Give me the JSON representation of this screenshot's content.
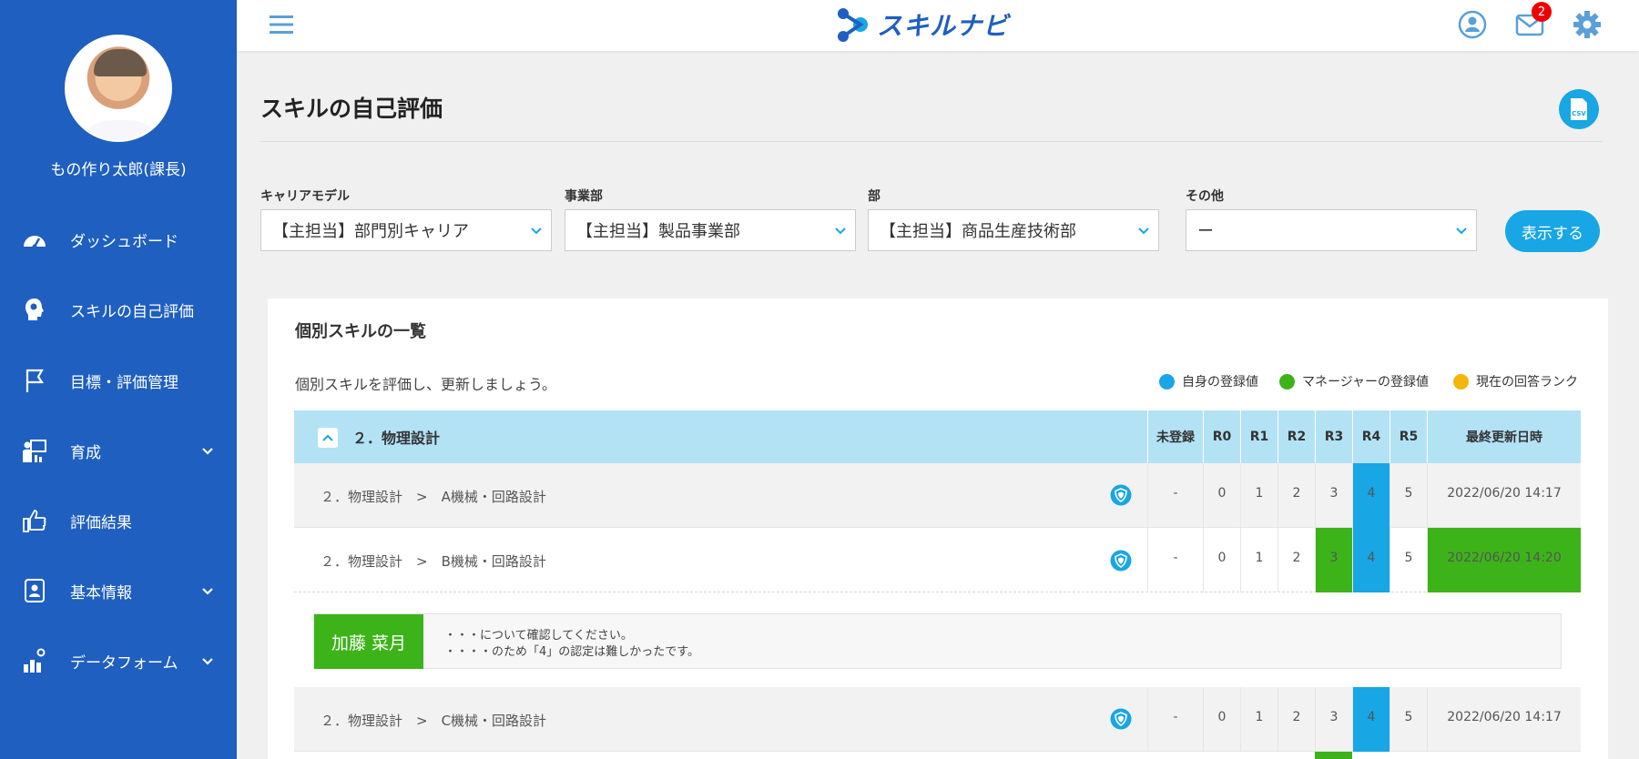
{
  "sidebar": {
    "user_name": "もの作り太郎(課長)",
    "items": [
      {
        "label": "ダッシュボード",
        "icon": "gauge-icon"
      },
      {
        "label": "スキルの自己評価",
        "icon": "brain-head-icon"
      },
      {
        "label": "目標・評価管理",
        "icon": "flag-icon"
      },
      {
        "label": "育成",
        "icon": "training-icon",
        "expandable": true
      },
      {
        "label": "評価結果",
        "icon": "thumbs-up-icon"
      },
      {
        "label": "基本情報",
        "icon": "id-card-icon",
        "expandable": true
      },
      {
        "label": "データフォーム",
        "icon": "chart-user-icon",
        "expandable": true
      }
    ]
  },
  "header": {
    "logo_text": "スキルナビ",
    "notification_count": "2"
  },
  "page": {
    "title": "スキルの自己評価",
    "csv_label": "CSV"
  },
  "filters": [
    {
      "label": "キャリアモデル",
      "value": "【主担当】部門別キャリア"
    },
    {
      "label": "事業部",
      "value": "【主担当】製品事業部"
    },
    {
      "label": "部",
      "value": "【主担当】商品生産技術部"
    },
    {
      "label": "その他",
      "value": "ー"
    }
  ],
  "show_button": "表示する",
  "card": {
    "title": "個別スキルの一覧",
    "subtitle": "個別スキルを評価し、更新しましょう。",
    "legend": [
      {
        "label": "自身の登録値",
        "color": "#18a6e4"
      },
      {
        "label": "マネージャーの登録値",
        "color": "#3db31a"
      },
      {
        "label": "現在の回答ランク",
        "color": "#f5b60a"
      }
    ]
  },
  "table": {
    "group_label": "２．物理設計",
    "headers": [
      "未登録",
      "R0",
      "R1",
      "R2",
      "R3",
      "R4",
      "R5",
      "最終更新日時"
    ],
    "rows": [
      {
        "name": "２．物理設計　>　A機械・回路設計",
        "cells": [
          "-",
          "0",
          "1",
          "2",
          "3",
          "4",
          "5",
          "2022/06/20 14:17"
        ]
      },
      {
        "name": "２．物理設計　>　B機械・回路設計",
        "cells": [
          "-",
          "0",
          "1",
          "2",
          "3",
          "4",
          "5",
          "2022/06/20 14:20"
        ]
      },
      {
        "name": "２．物理設計　>　C機械・回路設計",
        "cells": [
          "-",
          "0",
          "1",
          "2",
          "3",
          "4",
          "5",
          "2022/06/20 14:17"
        ]
      }
    ]
  },
  "comment": {
    "author": "加藤 菜月",
    "lines": [
      "・・・について確認してください。",
      "・・・・のため「4」の認定は難しかったです。"
    ]
  }
}
